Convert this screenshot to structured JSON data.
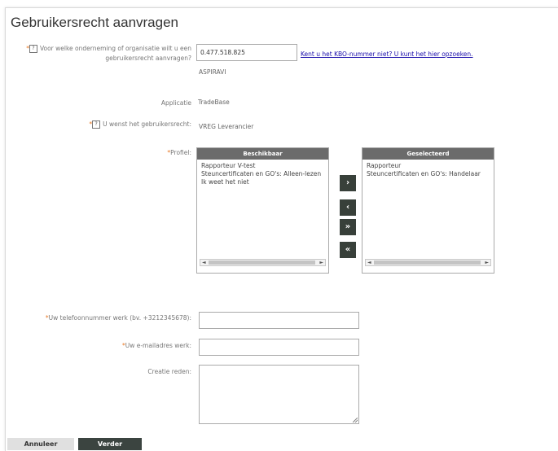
{
  "page": {
    "title": "Gebruikersrecht aanvragen"
  },
  "organisation": {
    "required_mark": "*",
    "help_icon": "?",
    "label_line1": "Voor welke onderneming of organisatie wilt u een",
    "label_line2": "gebruikersrecht aanvragen?",
    "value": "0.477.518.825",
    "link": "Kent u het KBO-nummer niet? U kunt het hier opzoeken.",
    "company_name": "ASPIRAVI"
  },
  "application": {
    "label": "Applicatie",
    "value": "TradeBase"
  },
  "user_right": {
    "required_mark": "*",
    "help_icon": "?",
    "label": "U wenst het gebruikersrecht:",
    "value": "VREG Leverancier"
  },
  "profile": {
    "required_mark": "*",
    "label": "Profiel:",
    "available": {
      "header": "Beschikbaar",
      "items": [
        "Rapporteur V-test",
        "Steuncertificaten en GO's: Alleen-lezen",
        "Ik weet het niet"
      ]
    },
    "selected": {
      "header": "Geselecteerd",
      "items": [
        "Rapporteur",
        "Steuncertificaten en GO's: Handelaar"
      ]
    },
    "buttons": {
      "add": "›",
      "remove": "‹",
      "add_all": "»",
      "remove_all": "«"
    },
    "scroll_arrows": {
      "left": "◄",
      "right": "►"
    }
  },
  "phone": {
    "required_mark": "*",
    "label": "Uw telefoonnummer werk (bv. +3212345678):",
    "value": ""
  },
  "email": {
    "required_mark": "*",
    "label": "Uw e-mailadres werk:",
    "value": ""
  },
  "reason": {
    "label": "Creatie reden:",
    "value": ""
  },
  "footer": {
    "cancel": "Annuleer",
    "next": "Verder"
  },
  "colors": {
    "required": "#e87722",
    "list_header": "#6b6b6b",
    "move_button": "#38403a",
    "primary_button": "#3b4440",
    "link": "#1a0dab"
  }
}
